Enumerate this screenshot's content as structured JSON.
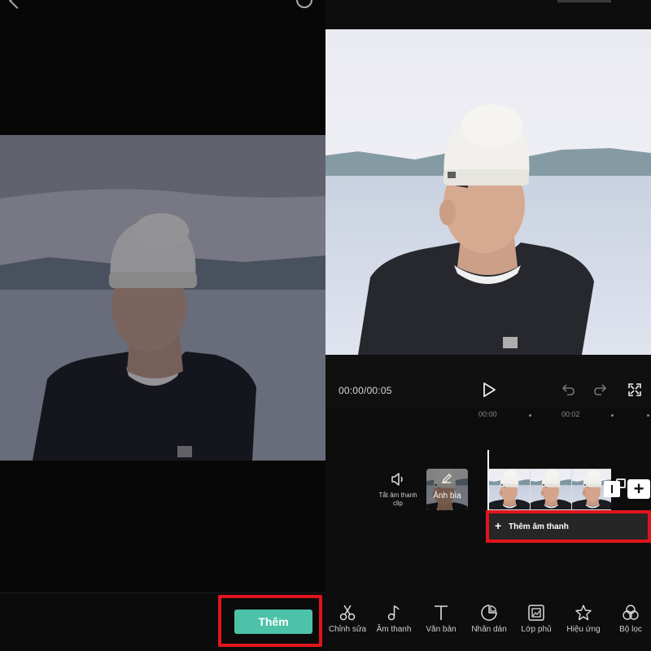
{
  "left": {
    "add_button_label": "Thêm"
  },
  "right": {
    "player": {
      "time": "00:00/00:05"
    },
    "ruler": {
      "labels": [
        "00:00",
        "00:02"
      ]
    },
    "timeline": {
      "mute_label": "Tắt âm thanh clip",
      "cover_label": "Ảnh bìa",
      "add_clip_label": "+",
      "add_audio_plus": "+",
      "add_audio_label": "Thêm âm thanh"
    },
    "toolbar": [
      {
        "label": "Chỉnh sửa",
        "icon": "scissors-icon"
      },
      {
        "label": "Âm thanh",
        "icon": "music-note-icon"
      },
      {
        "label": "Văn bản",
        "icon": "text-icon"
      },
      {
        "label": "Nhãn dán",
        "icon": "sticker-icon"
      },
      {
        "label": "Lớp phủ",
        "icon": "overlay-icon"
      },
      {
        "label": "Hiệu ứng",
        "icon": "effects-star-icon"
      },
      {
        "label": "Bộ lọc",
        "icon": "filter-icon"
      }
    ]
  },
  "colors": {
    "accent": "#4cc2a8",
    "highlight_frame": "#e0141c"
  }
}
